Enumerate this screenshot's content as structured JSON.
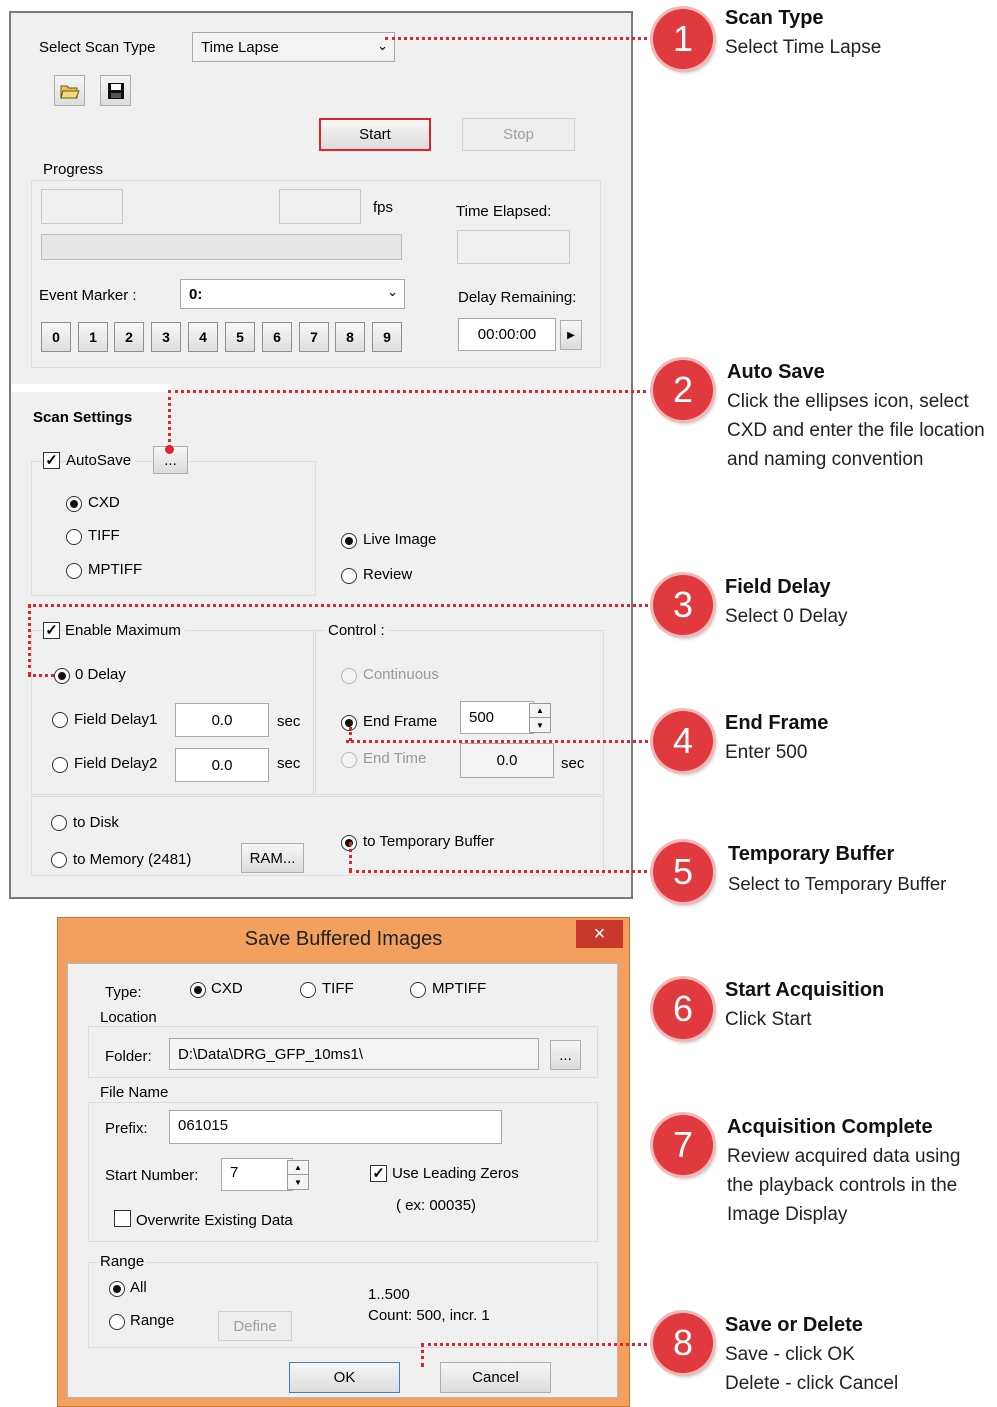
{
  "main": {
    "scan_type_label": "Select Scan Type",
    "scan_type_value": "Time Lapse",
    "start_label": "Start",
    "stop_label": "Stop",
    "progress_label": "Progress",
    "fps_label": "fps",
    "time_elapsed_label": "Time Elapsed:",
    "event_marker_label": "Event Marker :",
    "event_marker_value": "0:",
    "delay_remaining_label": "Delay Remaining:",
    "delay_remaining_value": "00:00:00",
    "marker_buttons": [
      "0",
      "1",
      "2",
      "3",
      "4",
      "5",
      "6",
      "7",
      "8",
      "9"
    ],
    "scan_settings_label": "Scan Settings",
    "autosave_label": "AutoSave",
    "autosave_checked": true,
    "ellipsis_label": "...",
    "format_cxd": "CXD",
    "format_tiff": "TIFF",
    "format_mptiff": "MPTIFF",
    "live_image_label": "Live Image",
    "review_label": "Review",
    "enable_maximum_label": "Enable Maximum",
    "control_label": "Control :",
    "zero_delay_label": "0 Delay",
    "field_delay1_label": "Field Delay1",
    "field_delay1_value": "0.0",
    "field_delay2_label": "Field Delay2",
    "field_delay2_value": "0.0",
    "sec_label": "sec",
    "continuous_label": "Continuous",
    "end_frame_label": "End Frame",
    "end_frame_value": "500",
    "end_time_label": "End Time",
    "end_time_value": "0.0",
    "to_disk_label": "to Disk",
    "to_memory_label": "to Memory (2481)",
    "ram_button_label": "RAM...",
    "to_temp_buffer_label": "to Temporary Buffer"
  },
  "save_dialog": {
    "title": "Save Buffered Images",
    "close_label": "×",
    "type_label": "Type:",
    "type_cxd": "CXD",
    "type_tiff": "TIFF",
    "type_mptiff": "MPTIFF",
    "location_label": "Location",
    "folder_label": "Folder:",
    "folder_value": "D:\\Data\\DRG_GFP_10ms1\\",
    "browse_label": "...",
    "file_name_label": "File Name",
    "prefix_label": "Prefix:",
    "prefix_value": "061015",
    "start_number_label": "Start Number:",
    "start_number_value": "7",
    "use_leading_zeros_label": "Use Leading Zeros",
    "leading_zeros_example": "( ex: 00035)",
    "overwrite_label": "Overwrite Existing Data",
    "range_group_label": "Range",
    "all_label": "All",
    "range_label": "Range",
    "define_label": "Define",
    "range_text": "1..500",
    "count_text": "Count: 500, incr. 1",
    "ok_label": "OK",
    "cancel_label": "Cancel"
  },
  "callouts": [
    {
      "number": "1",
      "title": "Scan Type",
      "desc": "Select Time Lapse"
    },
    {
      "number": "2",
      "title": "Auto Save",
      "desc": "Click the ellipses icon, select CXD and enter the file location and naming convention"
    },
    {
      "number": "3",
      "title": "Field Delay",
      "desc": "Select 0 Delay"
    },
    {
      "number": "4",
      "title": "End Frame",
      "desc": "Enter 500"
    },
    {
      "number": "5",
      "title": "Temporary Buffer",
      "desc": "Select to Temporary Buffer"
    },
    {
      "number": "6",
      "title": "Start Acquisition",
      "desc": "Click Start"
    },
    {
      "number": "7",
      "title": "Acquisition Complete",
      "desc": "Review acquired data using the playback controls in the Image Display"
    },
    {
      "number": "8",
      "title": "Save or Delete",
      "desc": "Save - click OK\nDelete - click Cancel"
    }
  ],
  "colors": {
    "callout_red": "#e03a3e",
    "dialog_frame": "#f3a05f",
    "dotted_line": "#e0242c"
  }
}
